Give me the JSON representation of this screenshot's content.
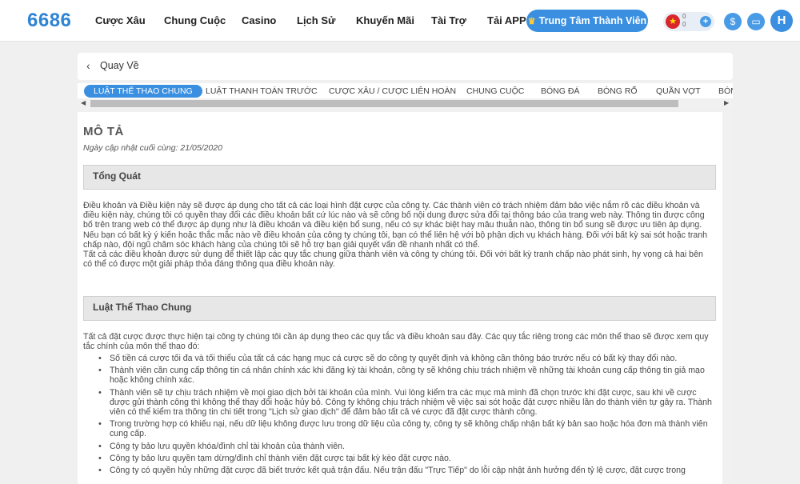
{
  "header": {
    "logo": "6686",
    "nav": [
      "Cược Xâu",
      "Chung Cuộc",
      "Casino",
      "Lịch Sử",
      "Khuyến Mãi",
      "Tài Trợ",
      "Tải APP"
    ],
    "member_center": "Trung Tâm Thành Viên",
    "balance": "0",
    "balance_sub": "0",
    "avatar_letter": "H",
    "accent_color": "#3a8fe0"
  },
  "back": {
    "label": "Quay Về"
  },
  "tabs": [
    "LUẬT THỂ THAO CHUNG",
    "LUẬT THANH TOÁN TRƯỚC",
    "CƯỢC XÂU / CƯỢC LIÊN HOÀN",
    "CHUNG CUỘC",
    "BÓNG ĐÁ",
    "BÓNG RỔ",
    "QUẦN VỢT",
    "BÓN"
  ],
  "content": {
    "title": "MÔ TẢ",
    "updated": "Ngày cập nhật cuối cùng: 21/05/2020",
    "section1": {
      "heading": "Tổng Quát",
      "paragraphs": [
        "Điều khoản và Điều kiện này sẽ được áp dụng cho tất cả các loại hình đặt cược của công ty. Các thành viên có trách nhiệm đảm bảo việc nắm rõ các điều khoản và điều kiện này, chúng tôi có quyền thay đổi các điều khoản bất cứ lúc nào và sẽ công bố nội dung được sửa đổi tại thông báo của trang web này. Thông tin được công bố trên trang web có thể được áp dụng như là điều khoản và điều kiện bổ sung, nếu có sự khác biệt hay mâu thuẫn nào, thông tin bổ sung sẽ được ưu tiên áp dụng.",
        "Nếu bạn có bất kỳ ý kiến hoặc thắc mắc nào về điều khoản của công ty chúng tôi, bạn có thể liên hệ với bộ phận dịch vụ khách hàng. Đối với bất kỳ sai sót hoặc tranh chấp nào, đội ngũ chăm sóc khách hàng của chúng tôi sẽ hỗ trợ bạn giải quyết vấn đề nhanh nhất có thể.",
        "Tất cả các điều khoản được sử dụng để thiết lập các quy tắc chung giữa thành viên và công ty chúng tôi. Đối với bất kỳ tranh chấp nào phát sinh, hy vọng cả hai bên có thể có được một giải pháp thỏa đáng thông qua điều khoản này."
      ]
    },
    "section2": {
      "heading": "Luật Thể Thao Chung",
      "intro": "Tất cả đặt cược được thực hiện tại công ty chúng tôi cần áp dụng theo các quy tắc và điều khoản sau đây. Các quy tắc riêng trong các môn thể thao sẽ được xem quy tắc chính của môn thể thao đó:",
      "bullets": [
        "Số tiền cá cược tối đa và tối thiểu của tất cả các hạng mục cá cược sẽ do công ty quyết định và không cần thông báo trước nếu có bất kỳ thay đổi nào.",
        "Thành viên cần cung cấp thông tin cá nhân chính xác khi đăng ký tài khoản, công ty sẽ không chịu trách nhiệm về những tài khoản cung cấp thông tin giả mạo hoặc không chính xác.",
        "Thành viên sẽ tự chịu trách nhiệm về mọi giao dịch bởi tài khoản của mình. Vui lòng kiểm tra các mục mà mình đã chọn trước khi đặt cược, sau khi về cược được gửi thành công thì không thể thay đổi hoặc hủy bỏ. Công ty không chịu trách nhiệm về việc sai sót hoặc đặt cược nhiều lần do thành viên tự gây ra. Thành viên có thể kiểm tra thông tin chi tiết trong \"Lịch sử giao dịch\" để đảm bảo tất cả vé cược đã đặt cược thành công.",
        "Trong trường hợp có khiếu nại, nếu dữ liệu không được lưu trong dữ liệu của công ty, công ty sẽ không chấp nhận bất kỳ bản sao hoặc hóa đơn mà thành viên cung cấp.",
        "Công ty bảo lưu quyền khóa/đình chỉ tài khoản của thành viên.",
        "Công ty bảo lưu quyền tạm dừng/đình chỉ thành viên đặt cược tại bất kỳ kèo đặt cược nào.",
        "Công ty có quyền hủy những đặt cược đã biết trước kết quả trận đấu. Nếu trận đấu \"Trực Tiếp\" do lỗi cập nhật ảnh hưởng đến tỷ lệ cược, đặt cược trong"
      ]
    }
  }
}
